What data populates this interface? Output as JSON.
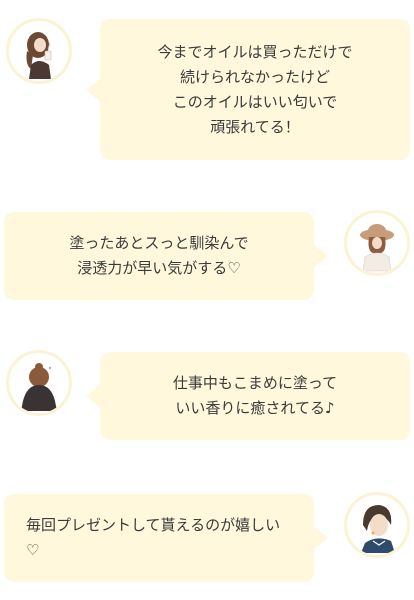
{
  "testimonials": [
    {
      "side": "left",
      "avatar_icon": "woman-long-hair-avatar-icon",
      "lines": [
        "今までオイルは買っただけで",
        "続けられなかったけど",
        "このオイルはいい匂いで",
        "頑張れてる！"
      ]
    },
    {
      "side": "right",
      "avatar_icon": "woman-hat-avatar-icon",
      "lines": [
        "塗ったあとスっと馴染んで",
        "浸透力が早い気がする♡"
      ]
    },
    {
      "side": "left",
      "avatar_icon": "woman-dark-coat-avatar-icon",
      "lines": [
        "仕事中もこまめに塗って",
        "いい香りに癒されてる♪"
      ]
    },
    {
      "side": "right",
      "avatar_icon": "woman-short-hair-avatar-icon",
      "text": "毎回プレゼントして貰えるのが嬉しい♡"
    }
  ],
  "colors": {
    "bubble": "#fff8dc",
    "avatar_border": "#fbf3d6",
    "text": "#3a3a3a"
  }
}
